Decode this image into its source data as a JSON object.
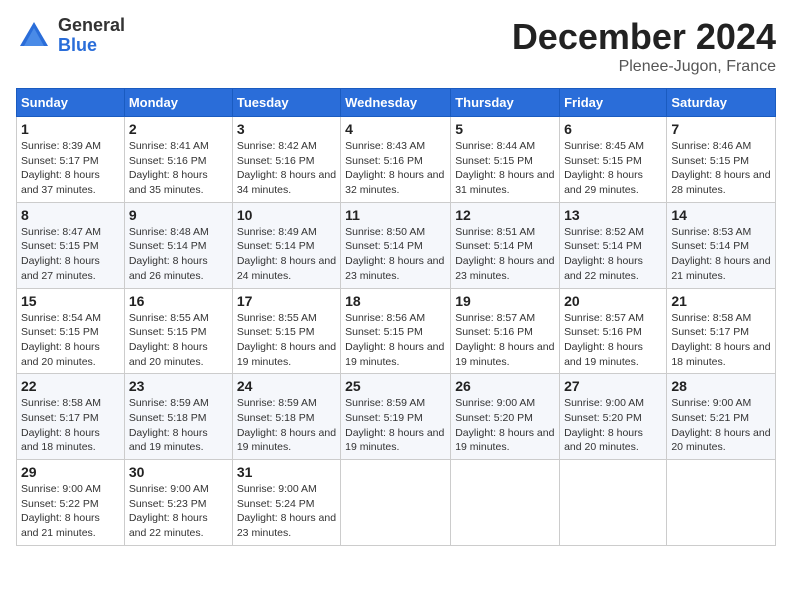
{
  "logo": {
    "general": "General",
    "blue": "Blue"
  },
  "title": "December 2024",
  "location": "Plenee-Jugon, France",
  "headers": [
    "Sunday",
    "Monday",
    "Tuesday",
    "Wednesday",
    "Thursday",
    "Friday",
    "Saturday"
  ],
  "weeks": [
    [
      {
        "day": "1",
        "sunrise": "8:39 AM",
        "sunset": "5:17 PM",
        "daylight": "8 hours and 37 minutes."
      },
      {
        "day": "2",
        "sunrise": "8:41 AM",
        "sunset": "5:16 PM",
        "daylight": "8 hours and 35 minutes."
      },
      {
        "day": "3",
        "sunrise": "8:42 AM",
        "sunset": "5:16 PM",
        "daylight": "8 hours and 34 minutes."
      },
      {
        "day": "4",
        "sunrise": "8:43 AM",
        "sunset": "5:16 PM",
        "daylight": "8 hours and 32 minutes."
      },
      {
        "day": "5",
        "sunrise": "8:44 AM",
        "sunset": "5:15 PM",
        "daylight": "8 hours and 31 minutes."
      },
      {
        "day": "6",
        "sunrise": "8:45 AM",
        "sunset": "5:15 PM",
        "daylight": "8 hours and 29 minutes."
      },
      {
        "day": "7",
        "sunrise": "8:46 AM",
        "sunset": "5:15 PM",
        "daylight": "8 hours and 28 minutes."
      }
    ],
    [
      {
        "day": "8",
        "sunrise": "8:47 AM",
        "sunset": "5:15 PM",
        "daylight": "8 hours and 27 minutes."
      },
      {
        "day": "9",
        "sunrise": "8:48 AM",
        "sunset": "5:14 PM",
        "daylight": "8 hours and 26 minutes."
      },
      {
        "day": "10",
        "sunrise": "8:49 AM",
        "sunset": "5:14 PM",
        "daylight": "8 hours and 24 minutes."
      },
      {
        "day": "11",
        "sunrise": "8:50 AM",
        "sunset": "5:14 PM",
        "daylight": "8 hours and 23 minutes."
      },
      {
        "day": "12",
        "sunrise": "8:51 AM",
        "sunset": "5:14 PM",
        "daylight": "8 hours and 23 minutes."
      },
      {
        "day": "13",
        "sunrise": "8:52 AM",
        "sunset": "5:14 PM",
        "daylight": "8 hours and 22 minutes."
      },
      {
        "day": "14",
        "sunrise": "8:53 AM",
        "sunset": "5:14 PM",
        "daylight": "8 hours and 21 minutes."
      }
    ],
    [
      {
        "day": "15",
        "sunrise": "8:54 AM",
        "sunset": "5:15 PM",
        "daylight": "8 hours and 20 minutes."
      },
      {
        "day": "16",
        "sunrise": "8:55 AM",
        "sunset": "5:15 PM",
        "daylight": "8 hours and 20 minutes."
      },
      {
        "day": "17",
        "sunrise": "8:55 AM",
        "sunset": "5:15 PM",
        "daylight": "8 hours and 19 minutes."
      },
      {
        "day": "18",
        "sunrise": "8:56 AM",
        "sunset": "5:15 PM",
        "daylight": "8 hours and 19 minutes."
      },
      {
        "day": "19",
        "sunrise": "8:57 AM",
        "sunset": "5:16 PM",
        "daylight": "8 hours and 19 minutes."
      },
      {
        "day": "20",
        "sunrise": "8:57 AM",
        "sunset": "5:16 PM",
        "daylight": "8 hours and 19 minutes."
      },
      {
        "day": "21",
        "sunrise": "8:58 AM",
        "sunset": "5:17 PM",
        "daylight": "8 hours and 18 minutes."
      }
    ],
    [
      {
        "day": "22",
        "sunrise": "8:58 AM",
        "sunset": "5:17 PM",
        "daylight": "8 hours and 18 minutes."
      },
      {
        "day": "23",
        "sunrise": "8:59 AM",
        "sunset": "5:18 PM",
        "daylight": "8 hours and 19 minutes."
      },
      {
        "day": "24",
        "sunrise": "8:59 AM",
        "sunset": "5:18 PM",
        "daylight": "8 hours and 19 minutes."
      },
      {
        "day": "25",
        "sunrise": "8:59 AM",
        "sunset": "5:19 PM",
        "daylight": "8 hours and 19 minutes."
      },
      {
        "day": "26",
        "sunrise": "9:00 AM",
        "sunset": "5:20 PM",
        "daylight": "8 hours and 19 minutes."
      },
      {
        "day": "27",
        "sunrise": "9:00 AM",
        "sunset": "5:20 PM",
        "daylight": "8 hours and 20 minutes."
      },
      {
        "day": "28",
        "sunrise": "9:00 AM",
        "sunset": "5:21 PM",
        "daylight": "8 hours and 20 minutes."
      }
    ],
    [
      {
        "day": "29",
        "sunrise": "9:00 AM",
        "sunset": "5:22 PM",
        "daylight": "8 hours and 21 minutes."
      },
      {
        "day": "30",
        "sunrise": "9:00 AM",
        "sunset": "5:23 PM",
        "daylight": "8 hours and 22 minutes."
      },
      {
        "day": "31",
        "sunrise": "9:00 AM",
        "sunset": "5:24 PM",
        "daylight": "8 hours and 23 minutes."
      },
      null,
      null,
      null,
      null
    ]
  ],
  "labels": {
    "sunrise": "Sunrise: ",
    "sunset": "Sunset: ",
    "daylight": "Daylight: "
  }
}
